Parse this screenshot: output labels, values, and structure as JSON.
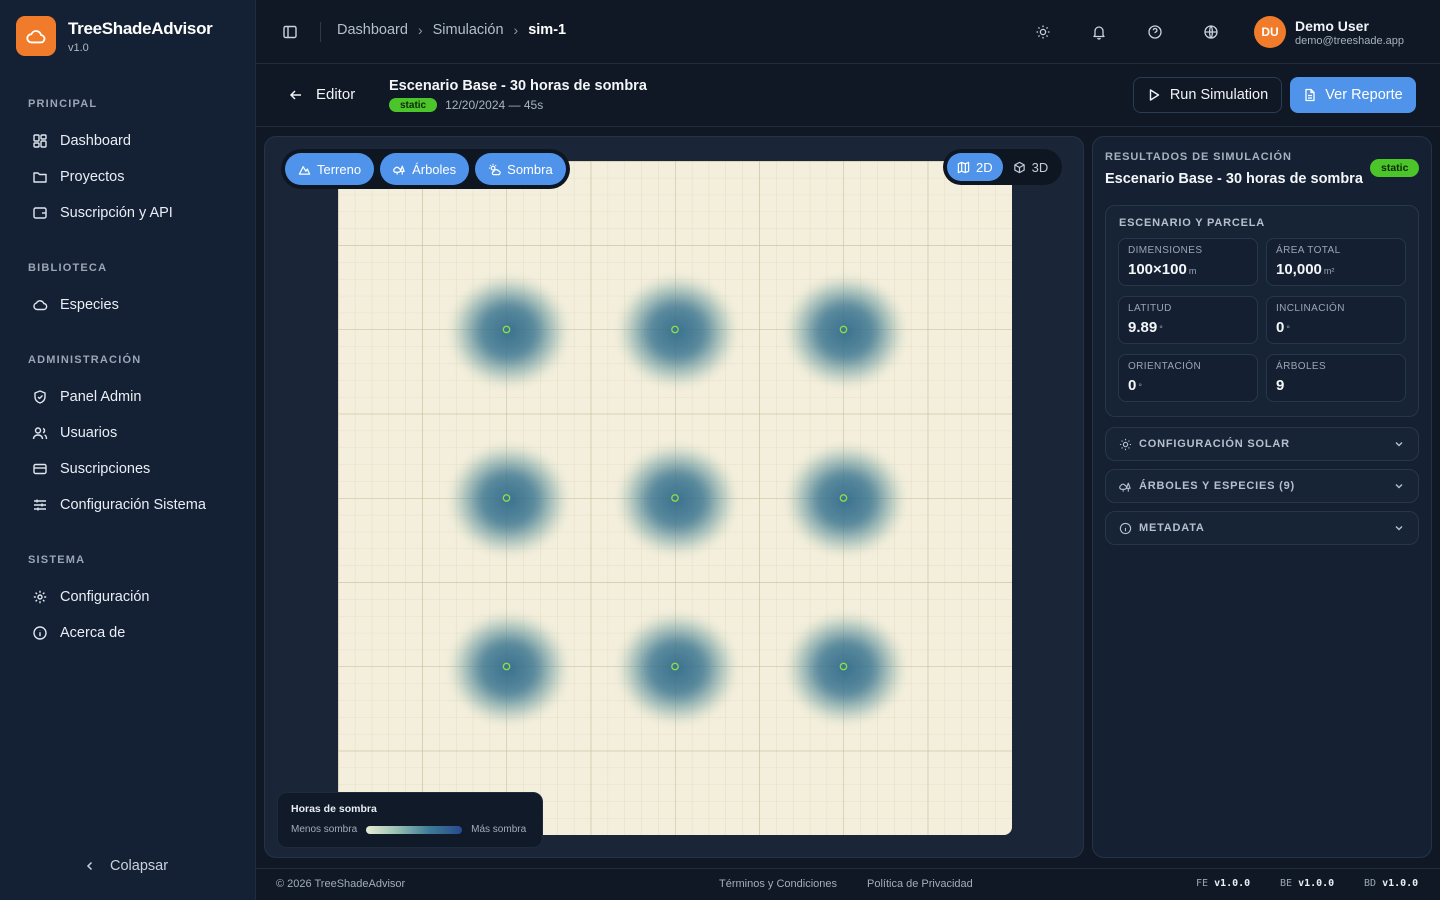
{
  "brand": {
    "name": "TreeShadeAdvisor",
    "version": "v1.0"
  },
  "sidebar": {
    "sections": [
      {
        "title": "PRINCIPAL",
        "items": [
          "Dashboard",
          "Proyectos",
          "Suscripción y API"
        ]
      },
      {
        "title": "BIBLIOTECA",
        "items": [
          "Especies"
        ]
      },
      {
        "title": "ADMINISTRACIÓN",
        "items": [
          "Panel Admin",
          "Usuarios",
          "Suscripciones",
          "Configuración Sistema"
        ]
      },
      {
        "title": "SISTEMA",
        "items": [
          "Configuración",
          "Acerca de"
        ]
      }
    ],
    "collapse_label": "Colapsar"
  },
  "breadcrumb": {
    "items": [
      "Dashboard",
      "Simulación"
    ],
    "current": "sim-1"
  },
  "user": {
    "initials": "DU",
    "name": "Demo User",
    "email": "demo@treeshade.app"
  },
  "editor": {
    "back_label": "Editor",
    "scenario_title": "Escenario Base - 30 horas de sombra",
    "status": "static",
    "date_duration": "12/20/2024 — 45s",
    "run_label": "Run Simulation",
    "report_label": "Ver Reporte"
  },
  "canvas": {
    "layers": [
      "Terreno",
      "Árboles",
      "Sombra"
    ],
    "views": [
      "2D",
      "3D"
    ],
    "active_view": "2D",
    "legend": {
      "title": "Horas de sombra",
      "min_label": "Menos sombra",
      "max_label": "Más sombra"
    },
    "trees": [
      {
        "col": 1,
        "row": 1
      },
      {
        "col": 2,
        "row": 1
      },
      {
        "col": 3,
        "row": 1
      },
      {
        "col": 1,
        "row": 2
      },
      {
        "col": 2,
        "row": 2
      },
      {
        "col": 3,
        "row": 2
      },
      {
        "col": 1,
        "row": 3
      },
      {
        "col": 2,
        "row": 3
      },
      {
        "col": 3,
        "row": 3
      }
    ],
    "colors": {
      "terrain": "#f4efdc",
      "shade": "#2f6a8a",
      "tree_marker": "#8fdc4a"
    }
  },
  "results": {
    "kicker": "RESULTADOS DE SIMULACIÓN",
    "title": "Escenario Base - 30 horas de sombra",
    "badge": "static",
    "card_title": "ESCENARIO Y PARCELA",
    "stats": [
      {
        "label": "DIMENSIONES",
        "value": "100×100",
        "unit": "m"
      },
      {
        "label": "ÁREA TOTAL",
        "value": "10,000",
        "unit": "m²"
      },
      {
        "label": "LATITUD",
        "value": "9.89",
        "unit": "°"
      },
      {
        "label": "INCLINACIÓN",
        "value": "0",
        "unit": "°"
      },
      {
        "label": "ORIENTACIÓN",
        "value": "0",
        "unit": "°"
      },
      {
        "label": "ÁRBOLES",
        "value": "9",
        "unit": ""
      }
    ],
    "accordions": [
      "CONFIGURACIÓN SOLAR",
      "ÁRBOLES Y ESPECIES (9)",
      "METADATA"
    ]
  },
  "footer": {
    "copyright": "© 2026 TreeShadeAdvisor",
    "links": [
      "Términos y Condiciones",
      "Política de Privacidad"
    ],
    "versions": [
      {
        "key": "FE",
        "value": "v1.0.0"
      },
      {
        "key": "BE",
        "value": "v1.0.0"
      },
      {
        "key": "BD",
        "value": "v1.0.0"
      }
    ]
  },
  "accent_colors": {
    "primary": "#4f94ea",
    "brand": "#f07b2a",
    "success": "#4cc52a"
  }
}
